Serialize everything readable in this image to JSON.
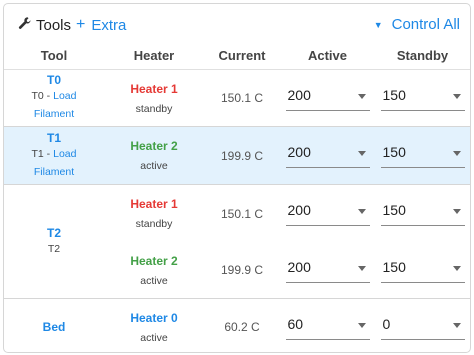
{
  "header": {
    "title": "Tools",
    "extra_label": "Extra",
    "control_all_label": "Control All"
  },
  "columns": [
    "Tool",
    "Heater",
    "Current",
    "Active",
    "Standby"
  ],
  "colors": {
    "accent": "#1e88e5",
    "heater_red": "#e53935",
    "heater_green": "#43a047",
    "heater_blue": "#1e88e5",
    "selected_row": "#e3f2fd"
  },
  "tools": [
    {
      "name": "T0",
      "sub_prefix": "T0 - ",
      "load_label": "Load",
      "load_label2": "Filament",
      "heaters": [
        {
          "name": "Heater 1",
          "state": "standby",
          "current": "150.1 C",
          "active": "200",
          "standby": "150"
        }
      ]
    },
    {
      "name": "T1",
      "sub_prefix": "T1 - ",
      "load_label": "Load",
      "load_label2": "Filament",
      "heaters": [
        {
          "name": "Heater 2",
          "state": "active",
          "current": "199.9 C",
          "active": "200",
          "standby": "150"
        }
      ]
    },
    {
      "name": "T2",
      "sub": "T2",
      "heaters": [
        {
          "name": "Heater 1",
          "state": "standby",
          "current": "150.1 C",
          "active": "200",
          "standby": "150"
        },
        {
          "name": "Heater 2",
          "state": "active",
          "current": "199.9 C",
          "active": "200",
          "standby": "150"
        }
      ]
    }
  ],
  "bed": {
    "name": "Bed",
    "heater": {
      "name": "Heater 0",
      "state": "active",
      "current": "60.2 C",
      "active": "60",
      "standby": "0"
    }
  }
}
